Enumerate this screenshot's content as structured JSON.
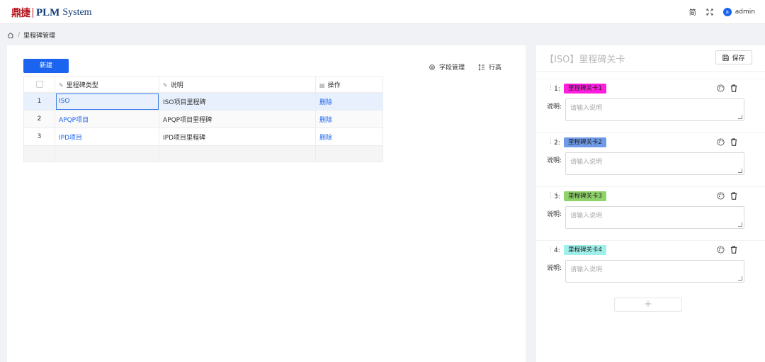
{
  "header": {
    "brand": "鼎捷",
    "product": "PLM",
    "system": "System",
    "lang": "简",
    "user_initial": "a",
    "user_name": "admin"
  },
  "breadcrumb": {
    "current": "里程碑管理"
  },
  "toolbar": {
    "new_label": "新建",
    "field_mgmt_label": "字段管理",
    "row_height_label": "行高"
  },
  "table": {
    "columns": [
      "里程碑类型",
      "说明",
      "操作"
    ],
    "rows": [
      {
        "index": "1",
        "type": "ISO",
        "desc": "ISO项目里程碑",
        "action": "删除"
      },
      {
        "index": "2",
        "type": "APQP项目",
        "desc": "APQP项目里程碑",
        "action": "删除"
      },
      {
        "index": "3",
        "type": "IPD项目",
        "desc": "IPD项目里程碑",
        "action": "删除"
      }
    ]
  },
  "side": {
    "title": "【ISO】里程碑关卡",
    "save_label": "保存",
    "desc_label": "说明:",
    "desc_placeholder": "请输入说明",
    "add_label": "+",
    "gates": [
      {
        "index": "1:",
        "name": "里程碑关卡1",
        "color": "#ff1ee0"
      },
      {
        "index": "2:",
        "name": "里程碑关卡2",
        "color": "#6e9ae8"
      },
      {
        "index": "3:",
        "name": "里程碑关卡3",
        "color": "#8fd46a"
      },
      {
        "index": "4:",
        "name": "里程碑关卡4",
        "color": "#9ff0ea"
      }
    ]
  },
  "colors": {
    "primary": "#1a64f0",
    "brand_red": "#b5121b",
    "brand_blue": "#0e3a78"
  }
}
